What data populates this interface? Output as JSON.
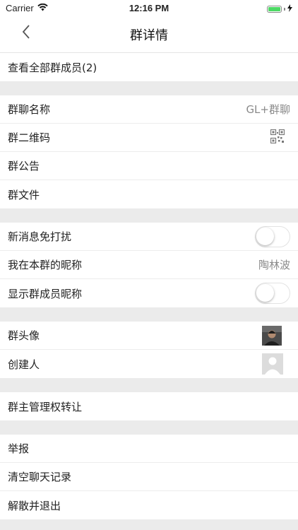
{
  "status_bar": {
    "carrier": "Carrier",
    "time": "12:16 PM",
    "wifi_icon": "wifi-icon",
    "battery_icon": "battery-charging-icon",
    "battery_level": 1.0,
    "battery_color": "#4cd964"
  },
  "nav": {
    "title": "群详情",
    "back_icon": "chevron-left-icon"
  },
  "members": {
    "view_all_label": "查看全部群成员(2)"
  },
  "group_info": {
    "name_label": "群聊名称",
    "name_value": "GL+群聊",
    "qr_label": "群二维码",
    "qr_icon": "qr-code-icon",
    "notice_label": "群公告",
    "files_label": "群文件"
  },
  "settings": {
    "dnd_label": "新消息免打扰",
    "dnd_on": false,
    "nickname_label": "我在本群的昵称",
    "nickname_value": "陶林波",
    "show_nicknames_label": "显示群成员昵称",
    "show_nicknames_on": false
  },
  "avatars": {
    "group_avatar_label": "群头像",
    "creator_label": "创建人"
  },
  "transfer": {
    "label": "群主管理权转让"
  },
  "actions": {
    "report_label": "举报",
    "clear_history_label": "清空聊天记录",
    "dissolve_label": "解散并退出"
  },
  "colors": {
    "background": "#ebebeb",
    "row_bg": "#ffffff",
    "value_text": "#8a8a8a"
  }
}
